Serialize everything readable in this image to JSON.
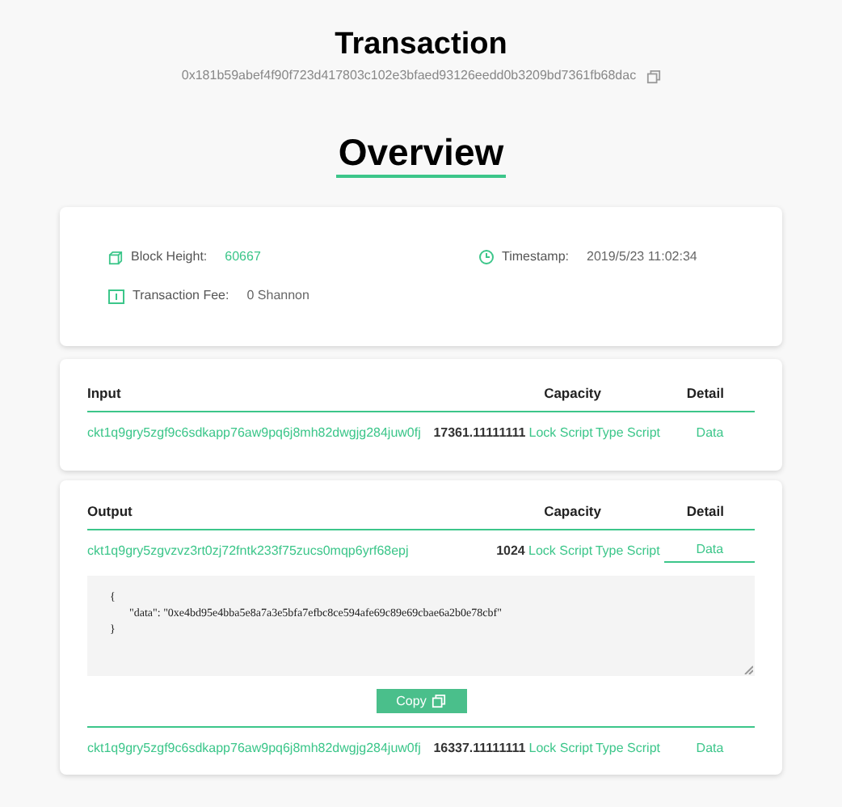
{
  "header": {
    "title": "Transaction",
    "hash": "0x181b59abef4f90f723d417803c102e3bfaed93126eedd0b3209bd7361fb68dac"
  },
  "overview": {
    "title": "Overview",
    "fields": [
      {
        "label": "Block Height:",
        "value": "60667",
        "kind": "link"
      },
      {
        "label": "Timestamp:",
        "value": "2019/5/23 11:02:34",
        "kind": "text"
      },
      {
        "label": "Transaction Fee:",
        "value": "0 Shannon",
        "kind": "text"
      }
    ]
  },
  "sections": [
    {
      "title": "Input",
      "capacity_header": "Capacity",
      "detail_header": "Detail",
      "rows": [
        {
          "address": "ckt1q9gry5zgf9c6sdkapp76aw9pq6j8mh82dwgjg284juw0fj",
          "capacity": "17361.11111111",
          "details": [
            {
              "label": "Lock Script",
              "selected": false
            },
            {
              "label": "Type Script",
              "selected": false
            },
            {
              "label": "Data",
              "selected": false
            }
          ]
        }
      ]
    },
    {
      "title": "Output",
      "capacity_header": "Capacity",
      "detail_header": "Detail",
      "rows": [
        {
          "address": "ckt1q9gry5zgvzvz3rt0zj72fntk233f75zucs0mqp6yrf68epj",
          "capacity": "1024",
          "details": [
            {
              "label": "Lock Script",
              "selected": false
            },
            {
              "label": "Type Script",
              "selected": false
            },
            {
              "label": "Data",
              "selected": true
            }
          ],
          "panel": {
            "lines": [
              "{",
              "\"data\": \"0xe4bd95e4bba5e8a7a3e5bfa7efbc8ce594afe69c89e69cbae6a2b0e78cbf\"",
              "}"
            ],
            "button": "Copy"
          }
        },
        {
          "address": "ckt1q9gry5zgf9c6sdkapp76aw9pq6j8mh82dwgjg284juw0fj",
          "capacity": "16337.11111111",
          "details": [
            {
              "label": "Lock Script",
              "selected": false
            },
            {
              "label": "Type Script",
              "selected": false
            },
            {
              "label": "Data",
              "selected": false
            }
          ]
        }
      ]
    }
  ]
}
